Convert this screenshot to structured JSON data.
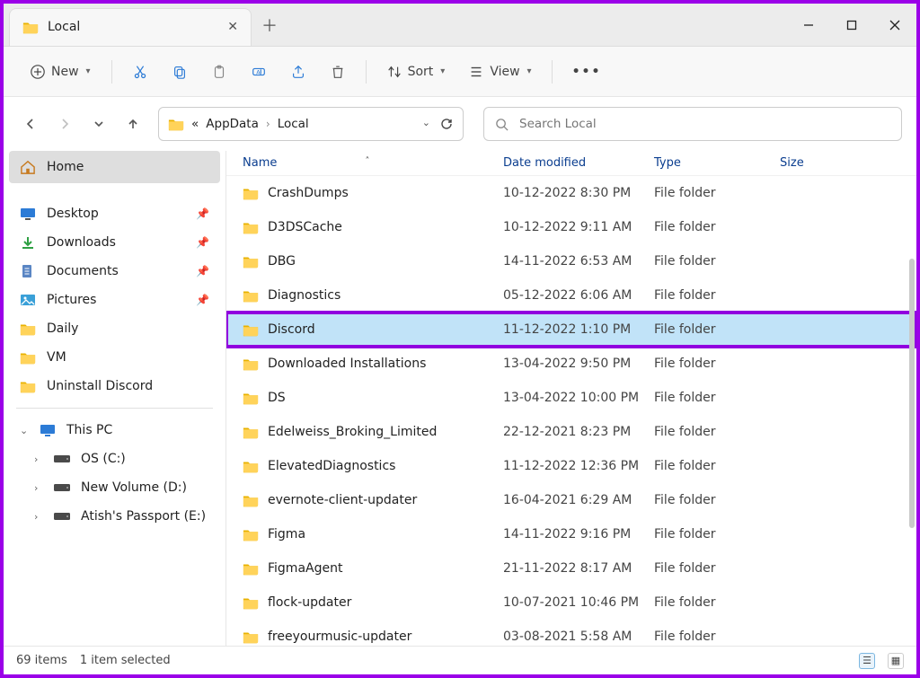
{
  "window": {
    "tab_title": "Local",
    "search_placeholder": "Search Local"
  },
  "toolbar": {
    "new_label": "New",
    "sort_label": "Sort",
    "view_label": "View"
  },
  "breadcrumb": {
    "prefix": "«",
    "seg1": "AppData",
    "seg2": "Local"
  },
  "columns": {
    "name": "Name",
    "date": "Date modified",
    "type": "Type",
    "size": "Size"
  },
  "sidebar": {
    "home": "Home",
    "quick": [
      {
        "label": "Desktop",
        "icon": "desktop"
      },
      {
        "label": "Downloads",
        "icon": "downloads"
      },
      {
        "label": "Documents",
        "icon": "documents"
      },
      {
        "label": "Pictures",
        "icon": "pictures"
      },
      {
        "label": "Daily",
        "icon": "folder"
      },
      {
        "label": "VM",
        "icon": "folder"
      },
      {
        "label": "Uninstall Discord",
        "icon": "folder"
      }
    ],
    "this_pc": "This PC",
    "drives": [
      {
        "label": "OS (C:)"
      },
      {
        "label": "New Volume (D:)"
      },
      {
        "label": "Atish's Passport  (E:)"
      }
    ]
  },
  "files": [
    {
      "name": "CrashDumps",
      "date": "10-12-2022 8:30 PM",
      "type": "File folder"
    },
    {
      "name": "D3DSCache",
      "date": "10-12-2022 9:11 AM",
      "type": "File folder"
    },
    {
      "name": "DBG",
      "date": "14-11-2022 6:53 AM",
      "type": "File folder"
    },
    {
      "name": "Diagnostics",
      "date": "05-12-2022 6:06 AM",
      "type": "File folder"
    },
    {
      "name": "Discord",
      "date": "11-12-2022 1:10 PM",
      "type": "File folder",
      "highlight": true
    },
    {
      "name": "Downloaded Installations",
      "date": "13-04-2022 9:50 PM",
      "type": "File folder"
    },
    {
      "name": "DS",
      "date": "13-04-2022 10:00 PM",
      "type": "File folder"
    },
    {
      "name": "Edelweiss_Broking_Limited",
      "date": "22-12-2021 8:23 PM",
      "type": "File folder"
    },
    {
      "name": "ElevatedDiagnostics",
      "date": "11-12-2022 12:36 PM",
      "type": "File folder"
    },
    {
      "name": "evernote-client-updater",
      "date": "16-04-2021 6:29 AM",
      "type": "File folder"
    },
    {
      "name": "Figma",
      "date": "14-11-2022 9:16 PM",
      "type": "File folder"
    },
    {
      "name": "FigmaAgent",
      "date": "21-11-2022 8:17 AM",
      "type": "File folder"
    },
    {
      "name": "flock-updater",
      "date": "10-07-2021 10:46 PM",
      "type": "File folder"
    },
    {
      "name": "freeyourmusic-updater",
      "date": "03-08-2021 5:58 AM",
      "type": "File folder"
    }
  ],
  "status": {
    "count": "69 items",
    "selected": "1 item selected"
  }
}
